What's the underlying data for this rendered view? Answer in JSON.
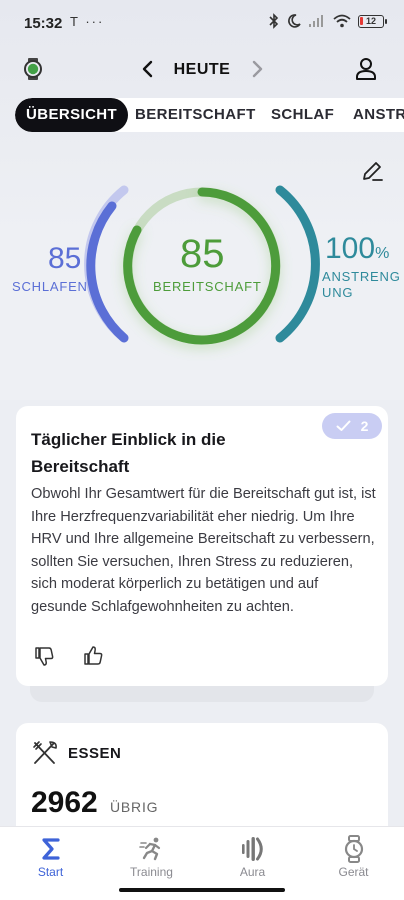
{
  "status_bar": {
    "time": "15:32",
    "left_icons": [
      "tesla-icon",
      "more-icon"
    ],
    "right_icons": [
      "bluetooth-icon",
      "moon-icon",
      "signal-icon",
      "wifi-icon"
    ],
    "battery": "12",
    "battery_color": "#e53935"
  },
  "header": {
    "date_label": "HEUTE",
    "watch_status_color": "#43a047"
  },
  "tabs": [
    {
      "label": "ÜBERSICHT",
      "active": true
    },
    {
      "label": "BEREITSCHAFT",
      "active": false
    },
    {
      "label": "SCHLAF",
      "active": false
    },
    {
      "label": "ANSTRENGUNG",
      "active": false
    }
  ],
  "scores": {
    "sleep": {
      "value": "85",
      "label": "SCHLAFEN",
      "color": "#5b6fd6"
    },
    "readiness": {
      "value": "85",
      "label": "BEREITSCHAFT",
      "color": "#4d9c3a"
    },
    "strain": {
      "value": "100",
      "unit": "%",
      "label_line1": "ANSTRENG",
      "label_line2": "UNG",
      "color": "#2e8a9b"
    }
  },
  "insight": {
    "title": "Täglicher Einblick in die Bereitschaft",
    "body": "Obwohl Ihr Gesamtwert für die Bereitschaft gut ist, ist Ihre Herzfrequenzvariabilität eher niedrig. Um Ihre HRV und Ihre allgemeine Bereitschaft zu verbessern, sollten Sie versuchen, Ihren Stress zu reduzieren, sich moderat körperlich zu betätigen und auf gesunde Schlafgewohnheiten zu achten.",
    "badge_count": "2",
    "badge_color": "#c9cdf3"
  },
  "essen": {
    "title": "ESSEN",
    "value": "2962",
    "unit": "ÜBRIG"
  },
  "bottom_nav": [
    {
      "label": "Start",
      "icon": "sigma-icon",
      "active": true
    },
    {
      "label": "Training",
      "icon": "runner-icon",
      "active": false
    },
    {
      "label": "Aura",
      "icon": "aura-icon",
      "active": false
    },
    {
      "label": "Gerät",
      "icon": "watch-icon",
      "active": false
    }
  ],
  "accent_color": "#3e63d8"
}
